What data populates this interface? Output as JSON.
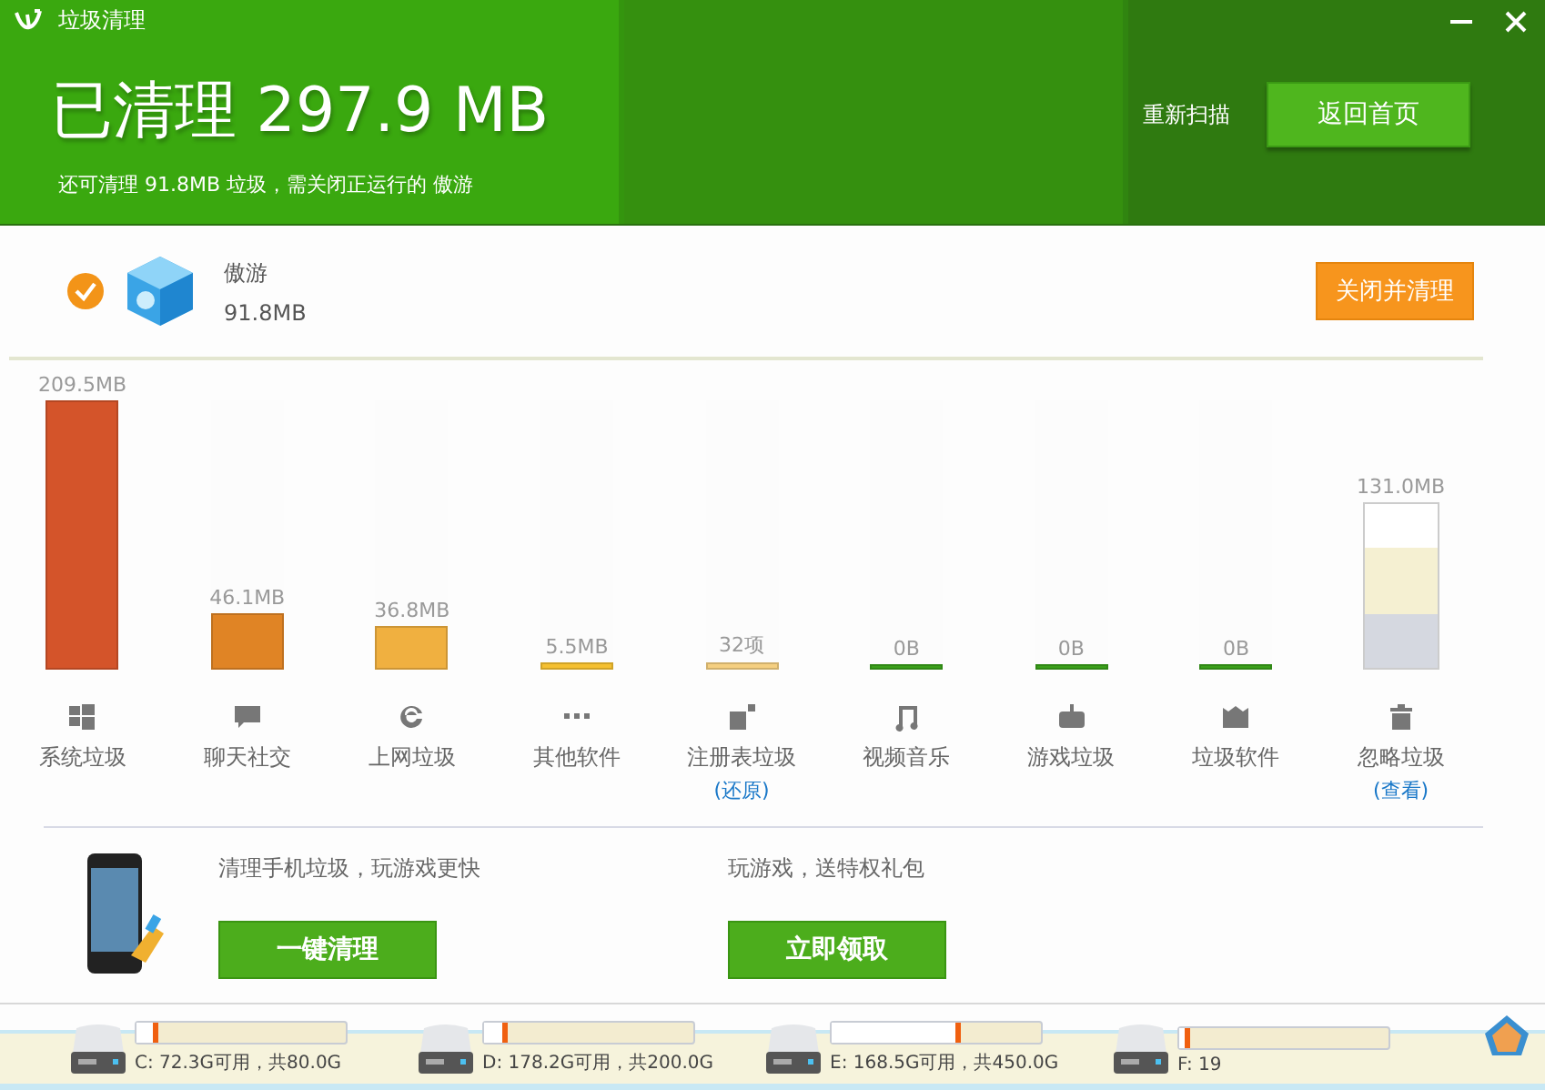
{
  "window": {
    "title": "垃圾清理"
  },
  "header": {
    "headline": "已清理 297.9 MB",
    "subtitle": "还可清理 91.8MB 垃圾，需关闭正运行的 傲游",
    "rescan": "重新扫描",
    "home_button": "返回首页"
  },
  "running_app": {
    "checked": true,
    "name": "傲游",
    "size": "91.8MB",
    "action": "关闭并清理"
  },
  "categories": [
    {
      "kind": "bar",
      "value": "209.5MB",
      "level": 1,
      "color": "#d4542a",
      "label": "系统垃圾"
    },
    {
      "kind": "bar",
      "value": "46.1MB",
      "level": 0.21,
      "color": "#e08425",
      "label": "聊天社交"
    },
    {
      "kind": "bar",
      "value": "36.8MB",
      "level": 0.16,
      "color": "#f0b040",
      "label": "上网垃圾"
    },
    {
      "kind": "bar",
      "value": "5.5MB",
      "level": 0.03,
      "color": "#f5c030",
      "label": "其他软件"
    },
    {
      "kind": "bar",
      "value": "32项",
      "level": 0.03,
      "color": "#f5cf80",
      "label": "注册表垃圾",
      "link": "(还原)"
    },
    {
      "kind": "bar",
      "value": "0B",
      "level": 0.02,
      "color": "#3aa01a",
      "label": "视频音乐"
    },
    {
      "kind": "bar",
      "value": "0B",
      "level": 0.02,
      "color": "#3aa01a",
      "label": "游戏垃圾"
    },
    {
      "kind": "bar",
      "value": "0B",
      "level": 0.02,
      "color": "#3aa01a",
      "label": "垃圾软件"
    },
    {
      "kind": "gauge",
      "value": "131.0MB",
      "level": 0.73,
      "color": "#f5f0d2",
      "label": "忽略垃圾",
      "link": "(查看)"
    }
  ],
  "promos": [
    {
      "text": "清理手机垃圾，玩游戏更快",
      "button": "一键清理"
    },
    {
      "text": "玩游戏，送特权礼包",
      "button": "立即领取"
    }
  ],
  "drives": [
    {
      "label": "C: 72.3G可用，共80.0G",
      "level": 0.1
    },
    {
      "label": "D: 178.2G可用，共200.0G",
      "level": 0.11
    },
    {
      "label": "E: 168.5G可用，共450.0G",
      "level": 0.62
    },
    {
      "label": "F: 19",
      "level": 0.05
    }
  ]
}
